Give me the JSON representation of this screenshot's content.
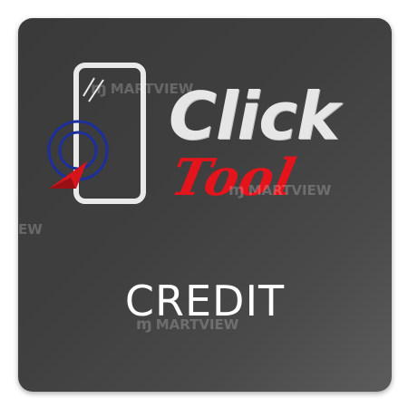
{
  "logo": {
    "word_top": "Click",
    "word_bottom": "Tool",
    "icon": "smartphone-tap-icon",
    "colors": {
      "click_text": "#e6e6e6",
      "tool_text": "#e3141b",
      "phone_outline": "#e9e9e9",
      "rings": "#1d2f9c",
      "pointer": "#d8141b"
    }
  },
  "label": "CREDIT",
  "watermark": {
    "text": "MARTVIEW",
    "edge_fragment": "EW",
    "mark_icon": "martview-logo-icon"
  },
  "colors": {
    "tile_background": "#3f3f3f",
    "page_background": "#ffffff"
  }
}
